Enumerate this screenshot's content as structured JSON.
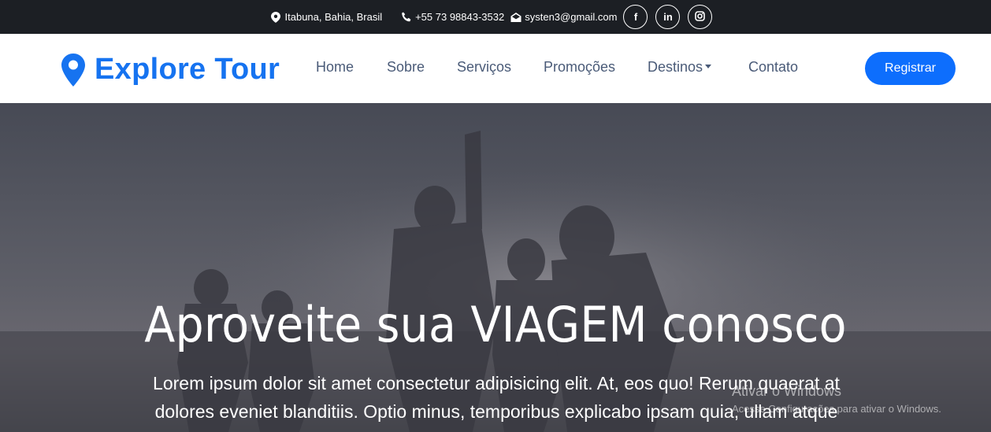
{
  "topbar": {
    "location": "Itabuna, Bahia, Brasil",
    "phone": "+55 73 98843-3532",
    "email": "systen3@gmail.com",
    "social": [
      {
        "icon": "facebook-icon",
        "glyph": "f"
      },
      {
        "icon": "linkedin-icon",
        "glyph": "in"
      },
      {
        "icon": "instagram-icon",
        "glyph": ""
      }
    ]
  },
  "navbar": {
    "brand": "Explore Tour",
    "items": [
      "Home",
      "Sobre",
      "Serviços",
      "Promoções",
      "Destinos",
      "Contato"
    ],
    "register_label": "Registrar"
  },
  "hero": {
    "title": "Aproveite sua VIAGEM conosco",
    "text": "Lorem ipsum dolor sit amet consectetur adipisicing elit. At, eos quo! Rerum quaerat at dolores eveniet blanditiis. Optio minus, temporibus explicabo ipsam quia, ullam atque"
  },
  "watermark": {
    "title": "Ativar o Windows",
    "subtitle": "Acesse Configurações para ativar o Windows."
  },
  "colors": {
    "topbar_bg": "#1c1f24",
    "brand": "#1673f0",
    "nav_text": "#4a5b78",
    "button": "#0d6efd"
  }
}
